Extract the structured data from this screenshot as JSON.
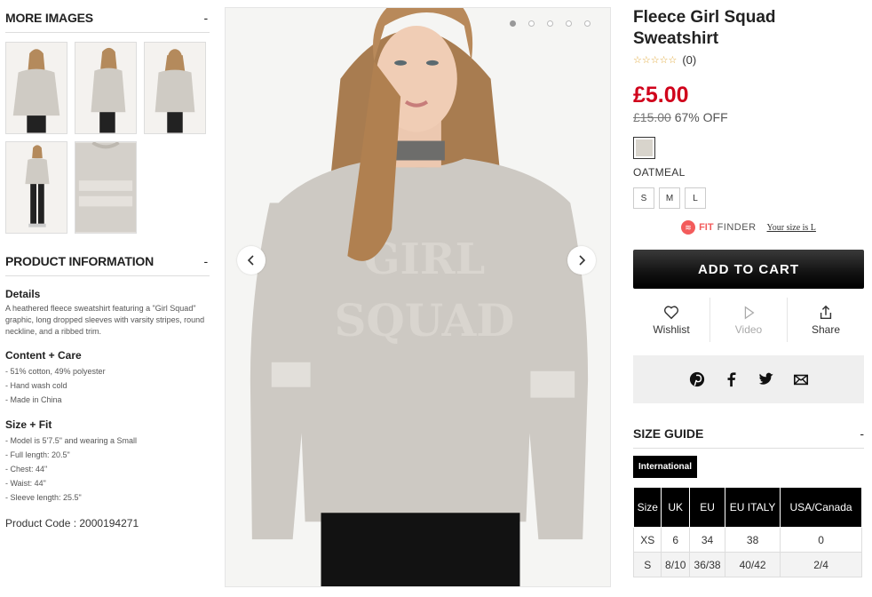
{
  "more_images": {
    "title": "MORE IMAGES",
    "toggle": "-",
    "count": 5
  },
  "product_info": {
    "title": "PRODUCT INFORMATION",
    "toggle": "-",
    "details_heading": "Details",
    "details_text": "A heathered fleece sweatshirt featuring a \"Girl Squad\" graphic, long dropped sleeves with varsity stripes, round neckline, and a ribbed trim.",
    "care_heading": "Content + Care",
    "care_items": [
      "- 51% cotton, 49% polyester",
      "- Hand wash cold",
      "- Made in China"
    ],
    "fit_heading": "Size + Fit",
    "fit_items": [
      "- Model is 5'7.5\" and wearing a Small",
      "- Full length: 20.5\"",
      "- Chest: 44\"",
      "- Waist: 44\"",
      "- Sleeve length: 25.5\""
    ],
    "product_code": "Product Code : 2000194271"
  },
  "gallery": {
    "slides": 5,
    "active": 0,
    "prev": "‹",
    "next": "›"
  },
  "product": {
    "title": "Fleece Girl Squad Sweatshirt",
    "stars": "☆☆☆☆☆",
    "review_count": "(0)",
    "price": "£5.00",
    "original_price": "£15.00",
    "discount": "67% OFF",
    "color_name": "OATMEAL",
    "swatch_color": "#d8d4cc",
    "sizes": [
      "S",
      "M",
      "L"
    ]
  },
  "fit_finder": {
    "brand_bold": "FIT",
    "brand_rest": "FINDER",
    "link": "Your size is L"
  },
  "add_to_cart": "ADD TO CART",
  "actions": {
    "wishlist": "Wishlist",
    "video": "Video",
    "share": "Share"
  },
  "size_guide": {
    "title": "SIZE GUIDE",
    "toggle": "-",
    "tab": "International",
    "headers": [
      "Size",
      "UK",
      "EU",
      "EU ITALY",
      "USA/Canada"
    ],
    "rows": [
      [
        "XS",
        "6",
        "34",
        "38",
        "0"
      ],
      [
        "S",
        "8/10",
        "36/38",
        "40/42",
        "2/4"
      ]
    ]
  },
  "colors": {
    "price_red": "#d0021b",
    "fit_red": "#f35b5b"
  }
}
